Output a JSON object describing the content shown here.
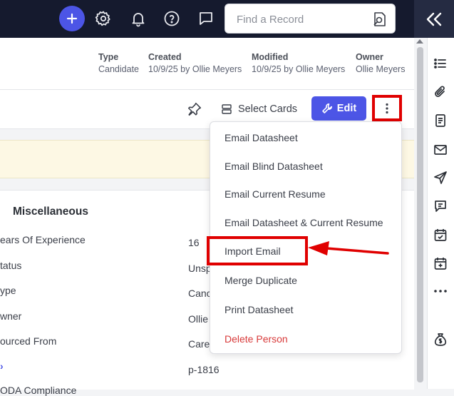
{
  "topbar": {
    "search_placeholder": "Find a Record"
  },
  "meta": {
    "type_label": "Type",
    "type_value": "Candidate",
    "created_label": "Created",
    "created_value": "10/9/25 by Ollie Meyers",
    "modified_label": "Modified",
    "modified_value": "10/9/25 by Ollie Meyers",
    "owner_label": "Owner",
    "owner_value": "Ollie Meyers"
  },
  "toolbar": {
    "select_cards_label": "Select Cards",
    "edit_label": "Edit"
  },
  "section": {
    "title": "Miscellaneous",
    "fields": [
      {
        "label": "ears Of Experience",
        "value": "16"
      },
      {
        "label": "tatus",
        "value": "Unsp"
      },
      {
        "label": "ype",
        "value": "Canc"
      },
      {
        "label": "wner",
        "value": "Ollie"
      },
      {
        "label": "ourced From",
        "value": "Care"
      },
      {
        "label": "",
        "value": "p-1816"
      },
      {
        "label": "ODA Compliance",
        "value": ""
      }
    ]
  },
  "menu": {
    "items": [
      {
        "label": "Email Datasheet"
      },
      {
        "label": "Email Blind Datasheet"
      },
      {
        "label": "Email Current Resume"
      },
      {
        "label": "Email Datasheet & Current Resume"
      },
      {
        "label": "Import Email"
      },
      {
        "label": "Merge Duplicate"
      },
      {
        "label": "Print Datasheet"
      },
      {
        "label": "Delete Person"
      }
    ]
  },
  "colors": {
    "accent": "#4c55e6",
    "topbar": "#151a2e",
    "danger": "#d83a3a",
    "annotation": "#e00000"
  },
  "icons": [
    "plus-icon",
    "gear-icon",
    "bell-icon",
    "help-icon",
    "chat-icon",
    "search-record-icon",
    "collapse-chevrons-icon",
    "list-icon",
    "paperclip-icon",
    "document-icon",
    "mail-icon",
    "send-icon",
    "comment-icon",
    "calendar-check-icon",
    "calendar-plus-icon",
    "more-horizontal-icon",
    "money-bag-icon",
    "pin-icon",
    "cards-icon",
    "wrench-icon",
    "more-vertical-icon"
  ]
}
